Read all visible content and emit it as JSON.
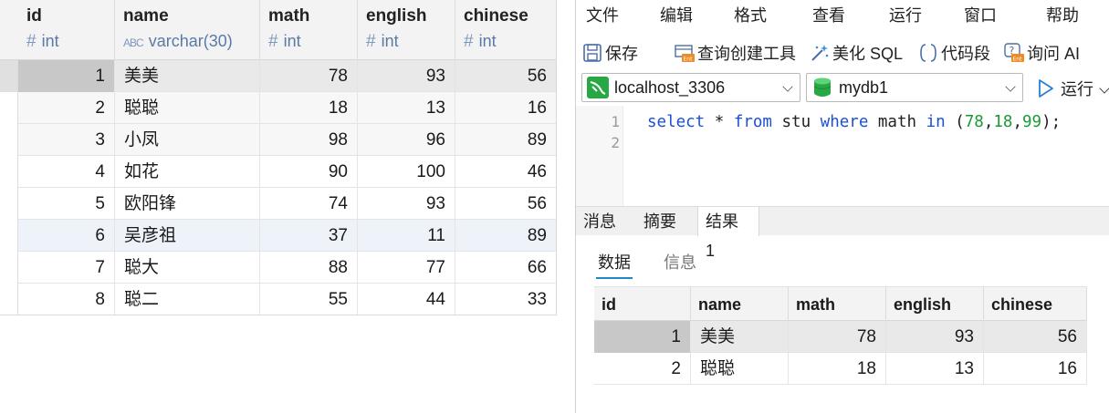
{
  "left_grid": {
    "columns": [
      {
        "name": "id",
        "type": "int",
        "type_icon": "hash-icon"
      },
      {
        "name": "name",
        "type": "varchar(30)",
        "type_icon": "abc-icon"
      },
      {
        "name": "math",
        "type": "int",
        "type_icon": "hash-icon"
      },
      {
        "name": "english",
        "type": "int",
        "type_icon": "hash-icon"
      },
      {
        "name": "chinese",
        "type": "int",
        "type_icon": "hash-icon"
      }
    ],
    "rows": [
      {
        "id": "1",
        "name": "美美",
        "math": "78",
        "english": "93",
        "chinese": "56"
      },
      {
        "id": "2",
        "name": "聪聪",
        "math": "18",
        "english": "13",
        "chinese": "16"
      },
      {
        "id": "3",
        "name": "小凤",
        "math": "98",
        "english": "96",
        "chinese": "89"
      },
      {
        "id": "4",
        "name": "如花",
        "math": "90",
        "english": "100",
        "chinese": "46"
      },
      {
        "id": "5",
        "name": "欧阳锋",
        "math": "74",
        "english": "93",
        "chinese": "56"
      },
      {
        "id": "6",
        "name": "吴彦祖",
        "math": "37",
        "english": "11",
        "chinese": "89"
      },
      {
        "id": "7",
        "name": "聪大",
        "math": "88",
        "english": "77",
        "chinese": "66"
      },
      {
        "id": "8",
        "name": "聪二",
        "math": "55",
        "english": "44",
        "chinese": "33"
      }
    ]
  },
  "menu": [
    "文件",
    "编辑",
    "格式",
    "查看",
    "运行",
    "窗口",
    "帮助"
  ],
  "toolbar": {
    "save": "保存",
    "query_builder": "查询创建工具",
    "beautify": "美化 SQL",
    "snippet": "代码段",
    "ask_ai": "询问 AI"
  },
  "connection": {
    "server": "localhost_3306",
    "database": "mydb1",
    "run": "运行"
  },
  "editor": {
    "line_numbers": [
      "1",
      "2"
    ],
    "sql": {
      "kw_select": "select",
      "star": " * ",
      "kw_from": "from",
      "table": " stu ",
      "kw_where": "where",
      "col": " math ",
      "kw_in": "in",
      "open": " (",
      "v1": "78",
      "c1": ",",
      "v2": "18",
      "c2": ",",
      "v3": "99",
      "close": ");"
    }
  },
  "result_tabs": [
    "消息",
    "摘要",
    "结果 1"
  ],
  "result_subtabs": [
    "数据",
    "信息"
  ],
  "result_grid": {
    "columns": [
      "id",
      "name",
      "math",
      "english",
      "chinese"
    ],
    "rows": [
      {
        "id": "1",
        "name": "美美",
        "math": "78",
        "english": "93",
        "chinese": "56"
      },
      {
        "id": "2",
        "name": "聪聪",
        "math": "18",
        "english": "13",
        "chinese": "16"
      }
    ]
  },
  "colors": {
    "keyword": "#1a4fd8",
    "number": "#1a9a37",
    "selected_row": "#e9e9e9",
    "accent": "#1e88c8"
  }
}
